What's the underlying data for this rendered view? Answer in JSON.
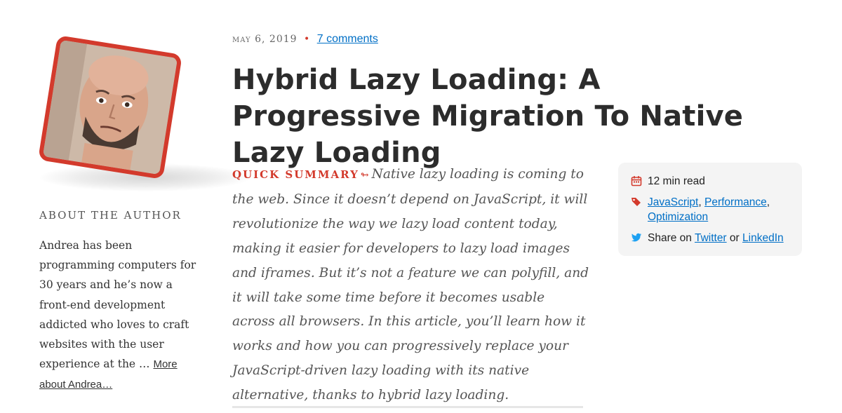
{
  "author": {
    "about_title": "About The Author",
    "bio": "Andrea has been programming computers for 30 years and he’s now a front-end development addicted who loves to craft websites with the user experience at the …",
    "more_link": "More about Andrea…"
  },
  "article": {
    "date": "May 6, 2019",
    "separator": "•",
    "comments_link": "7 comments",
    "title": "Hybrid Lazy Loading: A Progressive Migration To Native Lazy Loading",
    "summary_label": "Quick Summary",
    "summary_arrow": "↬",
    "summary_text": "Native lazy loading is coming to the web. Since it doesn’t depend on JavaScript, it will revolutionize the way we lazy load content today, making it easier for developers to lazy load images and iframes. But it’s not a feature we can polyfill, and it will take some time before it becomes usable across all browsers. In this article, you’ll learn how it works and how you can progressively replace your JavaScript-driven lazy loading with its native alternative, thanks to hybrid lazy loading."
  },
  "info": {
    "read_time": "12 min read",
    "tags": [
      "JavaScript",
      "Performance",
      "Optimization"
    ],
    "tag_separator": ",",
    "share_prefix": "Share on",
    "share_twitter": "Twitter",
    "share_or": "or",
    "share_linkedin": "LinkedIn"
  },
  "icons": {
    "calendar": "calendar-icon",
    "tag": "tag-icon",
    "twitter": "twitter-icon"
  },
  "colors": {
    "accent": "#d33a2c",
    "link": "#006fc6",
    "info_bg": "#f4f4f4",
    "twitter": "#1da1f2"
  }
}
